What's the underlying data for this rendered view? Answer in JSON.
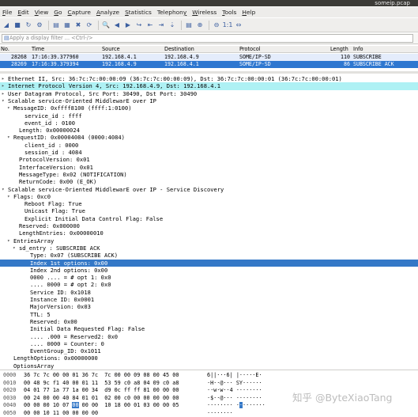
{
  "window": {
    "title": "someip.pcap"
  },
  "menu": [
    "File",
    "Edit",
    "View",
    "Go",
    "Capture",
    "Analyze",
    "Statistics",
    "Telephony",
    "Wireless",
    "Tools",
    "Help"
  ],
  "menu_underline": [
    "F",
    "E",
    "V",
    "G",
    "C",
    "A",
    "S",
    "y",
    "W",
    "T",
    "H"
  ],
  "toolbar": {
    "icons": [
      "shark-fin-start-icon",
      "stop-capture-icon",
      "restart-capture-icon",
      "capture-options-icon",
      "open-file-icon",
      "save-file-icon",
      "close-file-icon",
      "reload-icon",
      "find-packet-icon",
      "go-back-icon",
      "go-forward-icon",
      "go-to-packet-icon",
      "first-packet-icon",
      "last-packet-icon",
      "autoscroll-icon",
      "colorize-icon",
      "zoom-in-icon",
      "zoom-out-icon",
      "normal-size-icon",
      "resize-columns-icon"
    ],
    "glyphs": [
      "◢",
      "■",
      "↻",
      "⚙",
      "▤",
      "▦",
      "✖",
      "⟳",
      "🔍",
      "◀",
      "▶",
      "↪",
      "⇤",
      "⇥",
      "⇣",
      "▤",
      "⊕",
      "⊖",
      "1:1",
      "⇔"
    ]
  },
  "filter": {
    "placeholder": "Apply a display filter ... <Ctrl-/>",
    "bookmark_glyph": "▤"
  },
  "columns": {
    "no": "No.",
    "time": "Time",
    "source": "Source",
    "destination": "Destination",
    "protocol": "Protocol",
    "length": "Length",
    "info": "Info"
  },
  "packets": [
    {
      "no": "28268",
      "time": "17:16:39.377960",
      "source": "192.168.4.1",
      "destination": "192.168.4.9",
      "protocol": "SOME/IP-SD",
      "length": "110",
      "info": "SUBSCRIBE"
    },
    {
      "no": "28269",
      "time": "17:16:39.379394",
      "source": "192.168.4.9",
      "destination": "192.168.4.1",
      "protocol": "SOME/IP-SD",
      "length": "86",
      "info": "SUBSCRIBE ACK"
    }
  ],
  "details": [
    {
      "text": "Ethernet II, Src: 36:7c:7c:00:00:09 (36:7c:7c:00:00:09), Dst: 36:7c:7c:00:00:01 (36:7c:7c:00:00:01)",
      "indent": 0,
      "arrow": "▸",
      "style": ""
    },
    {
      "text": "Internet Protocol Version 4, Src: 192.168.4.9, Dst: 192.168.4.1",
      "indent": 0,
      "arrow": "▸",
      "style": "cyan"
    },
    {
      "text": "User Datagram Protocol, Src Port: 30490, Dst Port: 30490",
      "indent": 0,
      "arrow": "▸",
      "style": ""
    },
    {
      "text": "Scalable service-Oriented MiddlewarE over IP",
      "indent": 0,
      "arrow": "▾",
      "style": ""
    },
    {
      "text": "MessageID: 0xffff8100 (ffff:1:0100)",
      "indent": 1,
      "arrow": "▾",
      "style": ""
    },
    {
      "text": "service_id : ffff",
      "indent": 3,
      "arrow": "",
      "style": ""
    },
    {
      "text": "event_id : 0100",
      "indent": 3,
      "arrow": "",
      "style": ""
    },
    {
      "text": "Length: 0x00000024",
      "indent": 2,
      "arrow": "",
      "style": ""
    },
    {
      "text": "RequestID: 0x00004084 (0000:4084)",
      "indent": 1,
      "arrow": "▾",
      "style": ""
    },
    {
      "text": "client_id : 0000",
      "indent": 3,
      "arrow": "",
      "style": ""
    },
    {
      "text": "session_id : 4084",
      "indent": 3,
      "arrow": "",
      "style": ""
    },
    {
      "text": "ProtocolVersion: 0x01",
      "indent": 2,
      "arrow": "",
      "style": ""
    },
    {
      "text": "InterfaceVersion: 0x01",
      "indent": 2,
      "arrow": "",
      "style": ""
    },
    {
      "text": "MessageType: 0x02 (NOTIFICATION)",
      "indent": 2,
      "arrow": "",
      "style": ""
    },
    {
      "text": "ReturnCode: 0x00 (E_OK)",
      "indent": 2,
      "arrow": "",
      "style": ""
    },
    {
      "text": "Scalable service-Oriented MiddlewarE over IP - Service Discovery",
      "indent": 0,
      "arrow": "▾",
      "style": ""
    },
    {
      "text": "Flags: 0xc0",
      "indent": 1,
      "arrow": "▾",
      "style": ""
    },
    {
      "text": "Reboot Flag: True",
      "indent": 3,
      "arrow": "",
      "style": ""
    },
    {
      "text": "Unicast Flag: True",
      "indent": 3,
      "arrow": "",
      "style": ""
    },
    {
      "text": "Explicit Initial Data Control Flag: False",
      "indent": 3,
      "arrow": "",
      "style": ""
    },
    {
      "text": "Reserved: 0x000000",
      "indent": 2,
      "arrow": "",
      "style": ""
    },
    {
      "text": "LengthEntries: 0x00000010",
      "indent": 2,
      "arrow": "",
      "style": ""
    },
    {
      "text": "EntriesArray",
      "indent": 1,
      "arrow": "▾",
      "style": ""
    },
    {
      "text": "sd_entry : SUBSCRIBE ACK",
      "indent": 2,
      "arrow": "▾",
      "style": ""
    },
    {
      "text": "Type: 0x07 (SUBSCRIBE ACK)",
      "indent": 4,
      "arrow": "",
      "style": ""
    },
    {
      "text": "Index 1st options: 0x00",
      "indent": 4,
      "arrow": "",
      "style": "sel"
    },
    {
      "text": "Index 2nd options: 0x00",
      "indent": 4,
      "arrow": "",
      "style": ""
    },
    {
      "text": "0000 .... = # opt 1: 0x0",
      "indent": 4,
      "arrow": "",
      "style": ""
    },
    {
      "text": ".... 0000 = # opt 2: 0x0",
      "indent": 4,
      "arrow": "",
      "style": ""
    },
    {
      "text": "Service ID: 0x1018",
      "indent": 4,
      "arrow": "",
      "style": ""
    },
    {
      "text": "Instance ID: 0x0001",
      "indent": 4,
      "arrow": "",
      "style": ""
    },
    {
      "text": "MajorVersion: 0x03",
      "indent": 4,
      "arrow": "",
      "style": ""
    },
    {
      "text": "TTL: 5",
      "indent": 4,
      "arrow": "",
      "style": ""
    },
    {
      "text": "Reserved: 0x00",
      "indent": 4,
      "arrow": "",
      "style": ""
    },
    {
      "text": "Initial Data Requested Flag: False",
      "indent": 4,
      "arrow": "",
      "style": ""
    },
    {
      "text": ".... .000 = Reserved2: 0x0",
      "indent": 4,
      "arrow": "",
      "style": ""
    },
    {
      "text": ".... 0000 = Counter: 0",
      "indent": 4,
      "arrow": "",
      "style": ""
    },
    {
      "text": "EventGroup_ID: 0x1011",
      "indent": 4,
      "arrow": "",
      "style": ""
    },
    {
      "text": "LengthOptions: 0x00000000",
      "indent": 1,
      "arrow": "",
      "style": ""
    },
    {
      "text": "OptionsArray",
      "indent": 1,
      "arrow": "",
      "style": ""
    }
  ],
  "bytes": [
    {
      "offset": "0000",
      "hex": "36 7c 7c 00 00 01 36 7c  7c 00 00 09 08 00 45 00",
      "ascii": "6||···6| |·····E·"
    },
    {
      "offset": "0010",
      "hex": "00 48 9c f1 40 00 01 11  53 59 c0 a8 04 09 c0 a8",
      "ascii": "·H··@··· SY······"
    },
    {
      "offset": "0020",
      "hex": "04 01 77 1a 77 1a 00 34  d9 0c ff ff 81 00 00 00",
      "ascii": "··w·w··4 ········"
    },
    {
      "offset": "0030",
      "hex": "00 24 00 00 40 84 01 01  02 00 c0 00 00 00 00 00",
      "ascii": "·$··@··· ········"
    },
    {
      "offset": "0040",
      "hex_pre": "00 00 00 10 07 ",
      "hex_sel": "00",
      "hex_post": " 00 00  10 18 00 01 03 00 00 05",
      "ascii_pre": "········ ·",
      "ascii_sel": "·",
      "ascii_post": "·······"
    },
    {
      "offset": "0050",
      "hex": "00 00 10 11 00 00 00 00",
      "ascii": "········"
    }
  ],
  "watermark": "知乎 @ByteXiaoTang"
}
